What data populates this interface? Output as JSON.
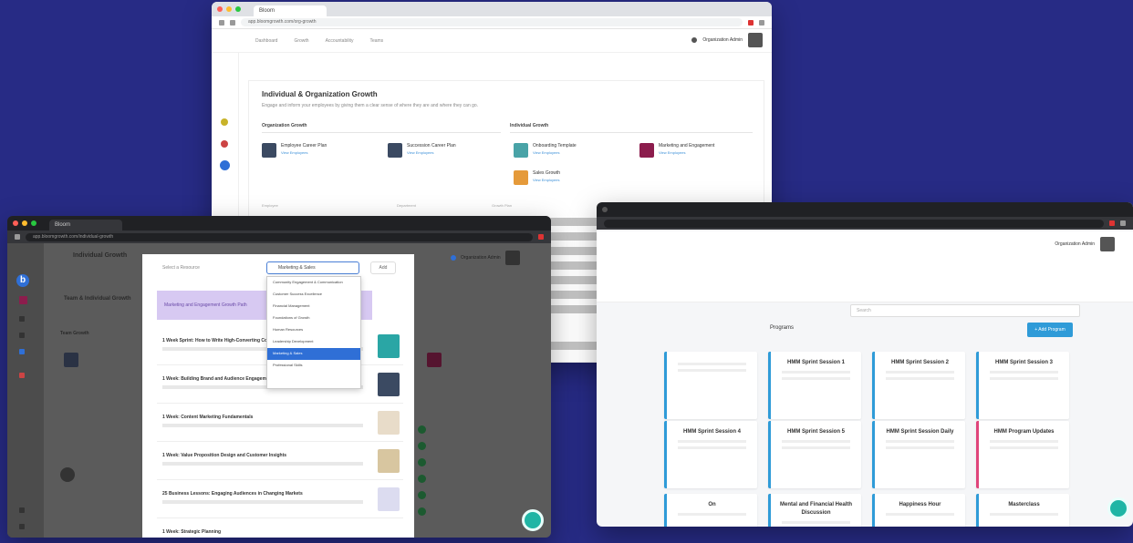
{
  "winA": {
    "tab_label": "Bloom",
    "url": "app.bloomgrowth.com/org-growth",
    "nav": [
      "Dashboard",
      "Growth",
      "Accountability",
      "Teams"
    ],
    "user": "Organization Admin",
    "card_title": "Individual & Organization Growth",
    "card_subtitle": "Engage and inform your employees by giving them a clear sense of where they are and where they can go.",
    "org_heading": "Organization Growth",
    "ind_heading": "Individual Growth",
    "org_paths": [
      {
        "name": "Employee Career Plan",
        "link": "View Employees",
        "color": "#3b4a62"
      },
      {
        "name": "Succession Career Plan",
        "link": "View Employees",
        "color": "#3b4a62"
      }
    ],
    "ind_paths": [
      {
        "name": "Onboarding Template",
        "link": "View Employees",
        "color": "#49a3a7"
      },
      {
        "name": "Marketing and Engagement",
        "link": "View Employees",
        "color": "#8c1d4d"
      },
      {
        "name": "Sales Growth",
        "link": "View Employees",
        "color": "#e59a3a"
      }
    ],
    "table_heads": [
      "Employee",
      "Department",
      "Growth Plan",
      "Status",
      "Actions"
    ]
  },
  "winB": {
    "tab_label": "Bloom",
    "url": "app.bloomgrowth.com/individual-growth",
    "page_title": "Individual Growth",
    "user": "Organization Admin",
    "section_title": "Team & Individual Growth",
    "sub_heading": "Team Growth",
    "modal_heading": "Select a Resource",
    "select_value": "Marketing & Sales",
    "modal_button": "Add",
    "highlight_text": "Marketing and Engagement Growth Path",
    "dropdown": [
      "Community Engagement & Communication",
      "Customer Success Excellence",
      "Financial Management",
      "Foundations of Growth",
      "Human Resources",
      "Leadership Development",
      "Marketing & Sales",
      "Professional Skills"
    ],
    "dropdown_selected_index": 6,
    "rows": [
      {
        "title": "1 Week Sprint: How to Write High-Converting Copy",
        "thumb": "#2aa6a5"
      },
      {
        "title": "1 Week: Building Brand and Audience Engagement",
        "thumb": "#3b4a62"
      },
      {
        "title": "1 Week: Content Marketing Fundamentals",
        "thumb": "#e8dcc9"
      },
      {
        "title": "1 Week: Value Proposition Design and Customer Insights",
        "thumb": "#d8c6a0"
      },
      {
        "title": "25 Business Lessons: Engaging Audiences in Changing Markets",
        "thumb": "#dcdcf0"
      },
      {
        "title": "1 Week: Strategic Planning",
        "thumb": "#cccccc"
      }
    ]
  },
  "winC": {
    "user": "Organization Admin",
    "search_placeholder": "Search",
    "tab_label": "Programs",
    "add_button": "+ Add Program",
    "programs": [
      {
        "title": "",
        "accent": "#2f9bd8"
      },
      {
        "title": "HMM Sprint Session 1",
        "accent": "#2f9bd8"
      },
      {
        "title": "HMM Sprint Session 2",
        "accent": "#2f9bd8"
      },
      {
        "title": "HMM Sprint Session 3",
        "accent": "#2f9bd8"
      },
      {
        "title": "HMM Sprint Session 4",
        "accent": "#2f9bd8"
      },
      {
        "title": "HMM Sprint Session 5",
        "accent": "#2f9bd8"
      },
      {
        "title": "HMM Sprint Session Daily",
        "accent": "#2f9bd8"
      },
      {
        "title": "HMM Program Updates",
        "accent": "#e0457b"
      },
      {
        "title": "On",
        "accent": "#2f9bd8"
      },
      {
        "title": "Mental and Financial Health Discussion",
        "accent": "#2f9bd8"
      },
      {
        "title": "Happiness Hour",
        "accent": "#2f9bd8"
      },
      {
        "title": "Masterclass",
        "accent": "#2f9bd8"
      }
    ]
  },
  "colors": {
    "background": "#272b85",
    "accent": "#2f9bd8",
    "chat": "#1fb5a5"
  }
}
